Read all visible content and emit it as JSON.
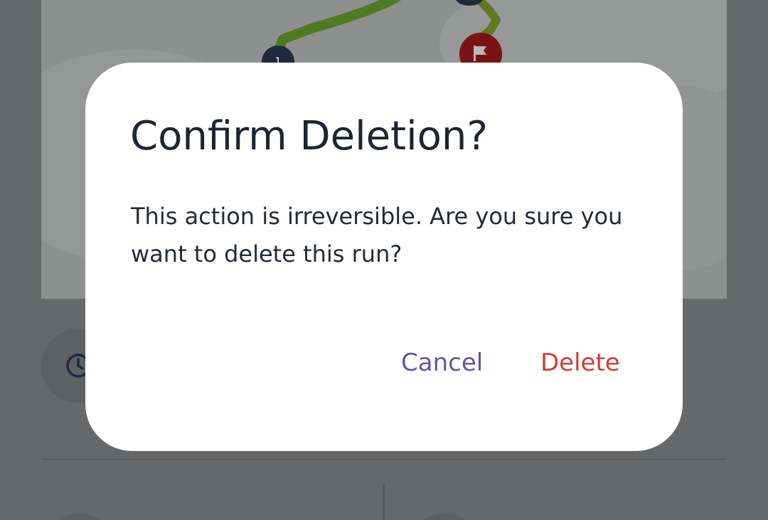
{
  "dialog": {
    "title": "Confirm Deletion?",
    "message": "This action is irreversible. Are you sure you want to delete this run?",
    "cancel_label": "Cancel",
    "delete_label": "Delete"
  },
  "map": {
    "start_marker_label": "1"
  },
  "colors": {
    "scrim": "#676869",
    "dialog_background": "#ffffff",
    "title_text": "#1d2433",
    "cancel_button": "#6552a5",
    "delete_button": "#d93a35"
  },
  "icons": {
    "finish_marker": "flag-icon",
    "duration_stat": "clock-icon"
  }
}
